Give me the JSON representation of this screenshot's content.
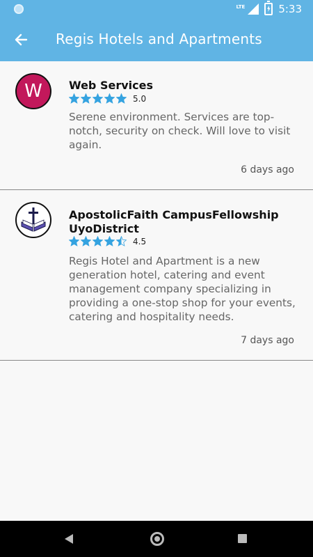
{
  "status_bar": {
    "network": "LTE",
    "time": "5:33"
  },
  "app_bar": {
    "title": "Regis Hotels and Apartments",
    "back_icon": "arrow-left-icon"
  },
  "colors": {
    "accent": "#60b4e4",
    "star": "#35a3e0",
    "avatar_w": "#c2185b"
  },
  "reviews": [
    {
      "avatar_letter": "W",
      "name": "Web Services",
      "rating": 5.0,
      "rating_label": "5.0",
      "text": "Serene environment. Services are top-notch, security on check. Will love to visit again.",
      "time": "6 days ago"
    },
    {
      "avatar_icon": "bible-cross-icon",
      "name": "ApostolicFaith CampusFellowship UyoDistrict",
      "rating": 4.5,
      "rating_label": "4.5",
      "text": "Regis Hotel and Apartment is a new generation hotel, catering and event management company specializing in providing a one-stop shop for your events, catering and hospitality needs.",
      "time": "7 days ago"
    }
  ]
}
